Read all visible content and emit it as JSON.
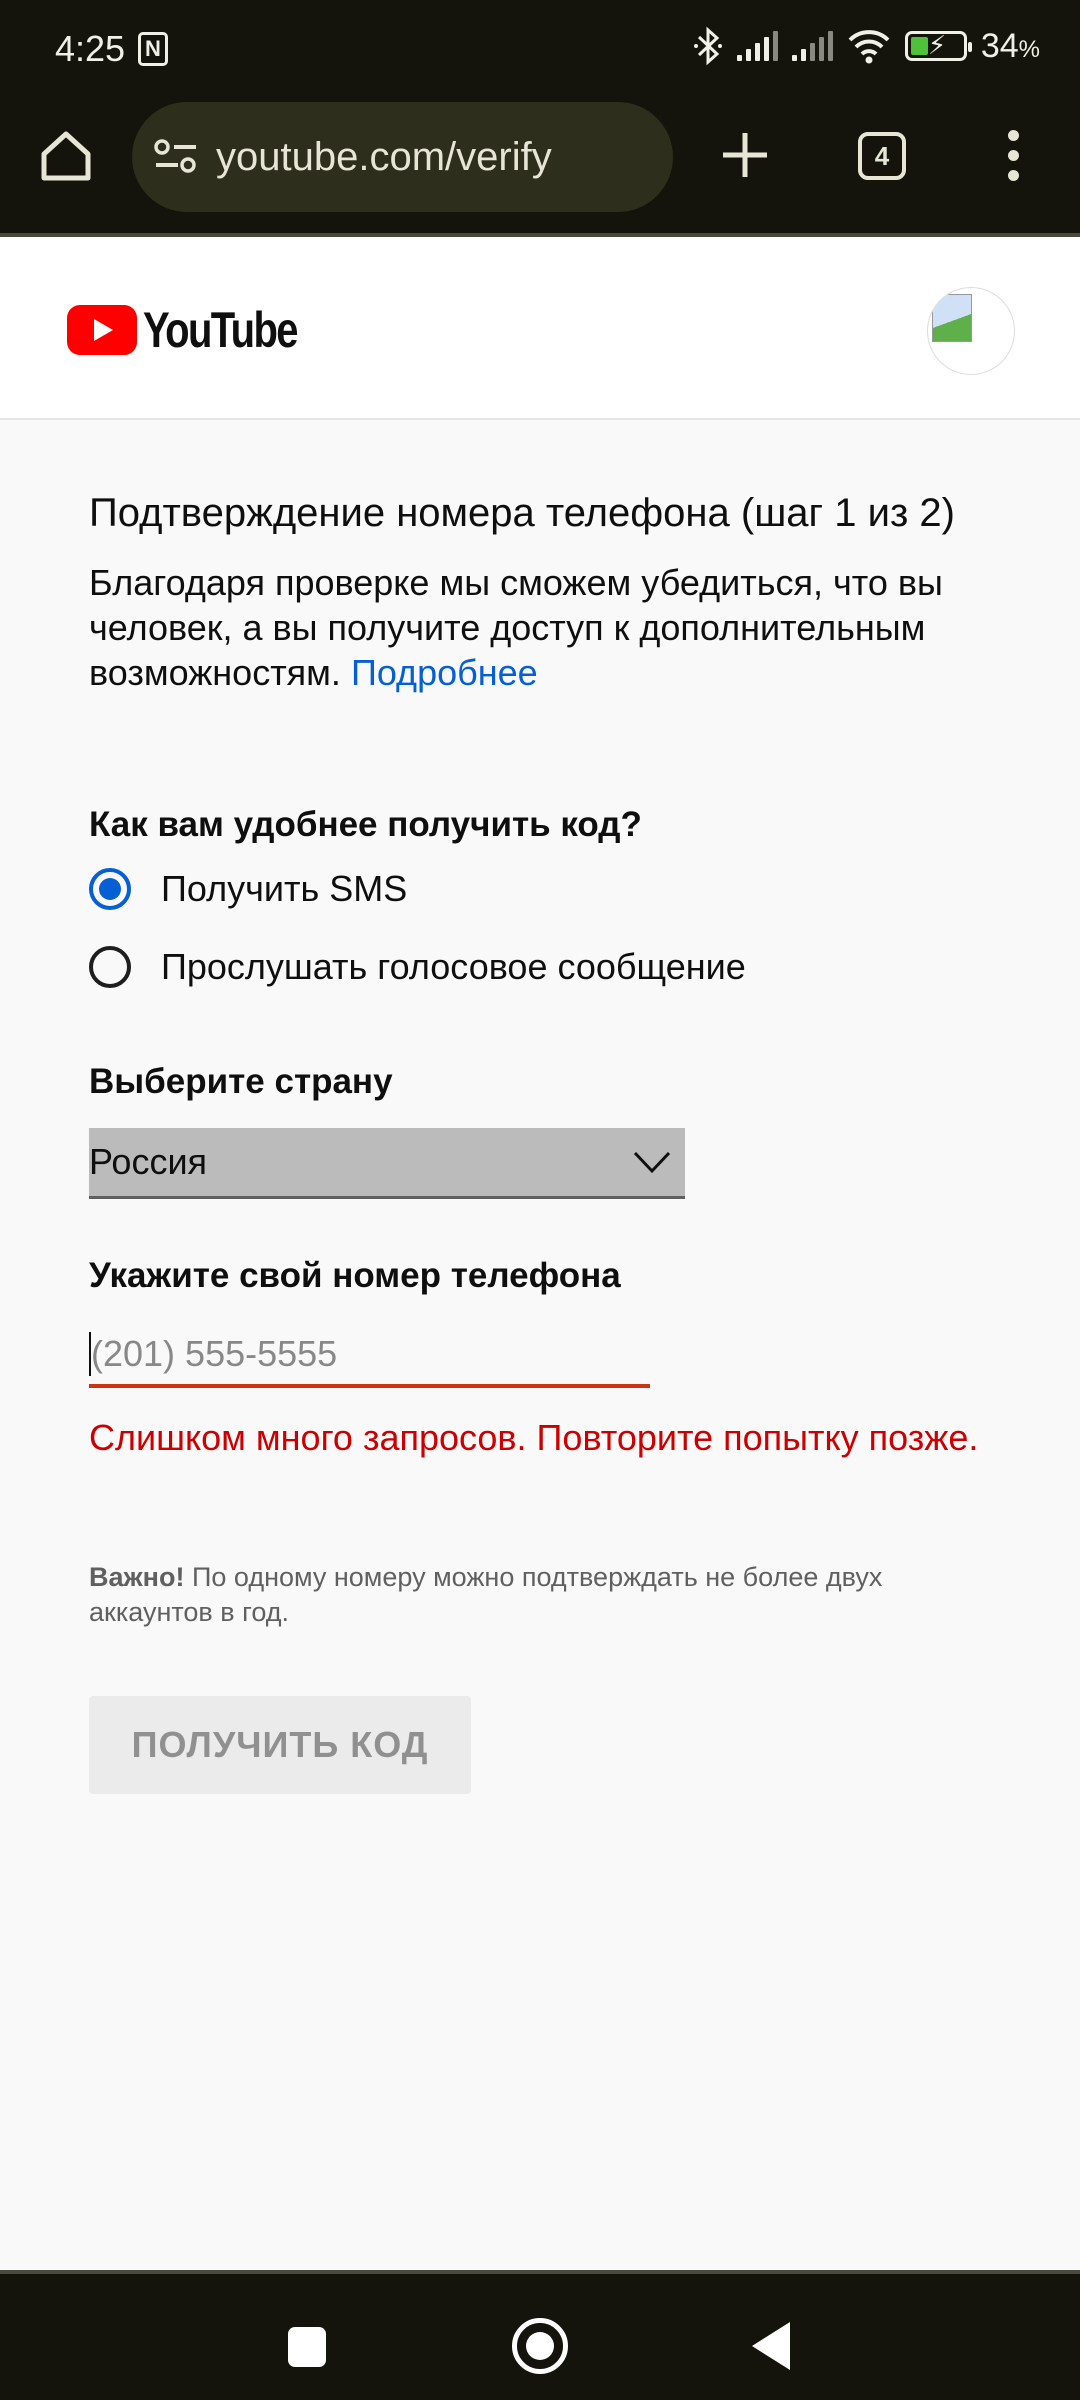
{
  "status_bar": {
    "time": "4:25",
    "nfc_label": "N",
    "battery_percent": "34",
    "battery_unit": "%",
    "battery_level": 0.34,
    "icons": [
      "nfc-icon",
      "bluetooth-icon",
      "signal-icon",
      "signal-icon",
      "wifi-icon",
      "battery-charging-icon"
    ]
  },
  "browser": {
    "url": "youtube.com/verify",
    "tab_count": "4",
    "icons": [
      "home-icon",
      "site-settings-icon",
      "new-tab-icon",
      "tabs-icon",
      "menu-icon"
    ]
  },
  "header": {
    "logo_text": "YouTube",
    "brand_color": "#ff0000"
  },
  "page": {
    "title": "Подтверждение номера телефона (шаг 1 из 2)",
    "description": "Благодаря проверке мы сможем убедиться, что вы человек, а вы получите доступ к дополнительным возможностям.",
    "learn_more": "Подробнее",
    "method_question": "Как вам удобнее получить код?",
    "methods": [
      {
        "label": "Получить SMS",
        "selected": true
      },
      {
        "label": "Прослушать голосовое сообщение",
        "selected": false
      }
    ],
    "country_label": "Выберите страну",
    "country_value": "Россия",
    "phone_label": "Укажите свой номер телефона",
    "phone_value": "",
    "phone_placeholder": "(201) 555-5555",
    "error": "Слишком много запросов. Повторите попытку позже.",
    "note_bold": "Важно!",
    "note_text": "По одному номеру можно подтверждать не более двух аккаунтов в год.",
    "submit_label": "ПОЛУЧИТЬ КОД",
    "accent_color": "#065fd4",
    "error_color": "#cc0000"
  },
  "nav_bar": {
    "buttons": [
      "recents",
      "home",
      "back"
    ]
  }
}
